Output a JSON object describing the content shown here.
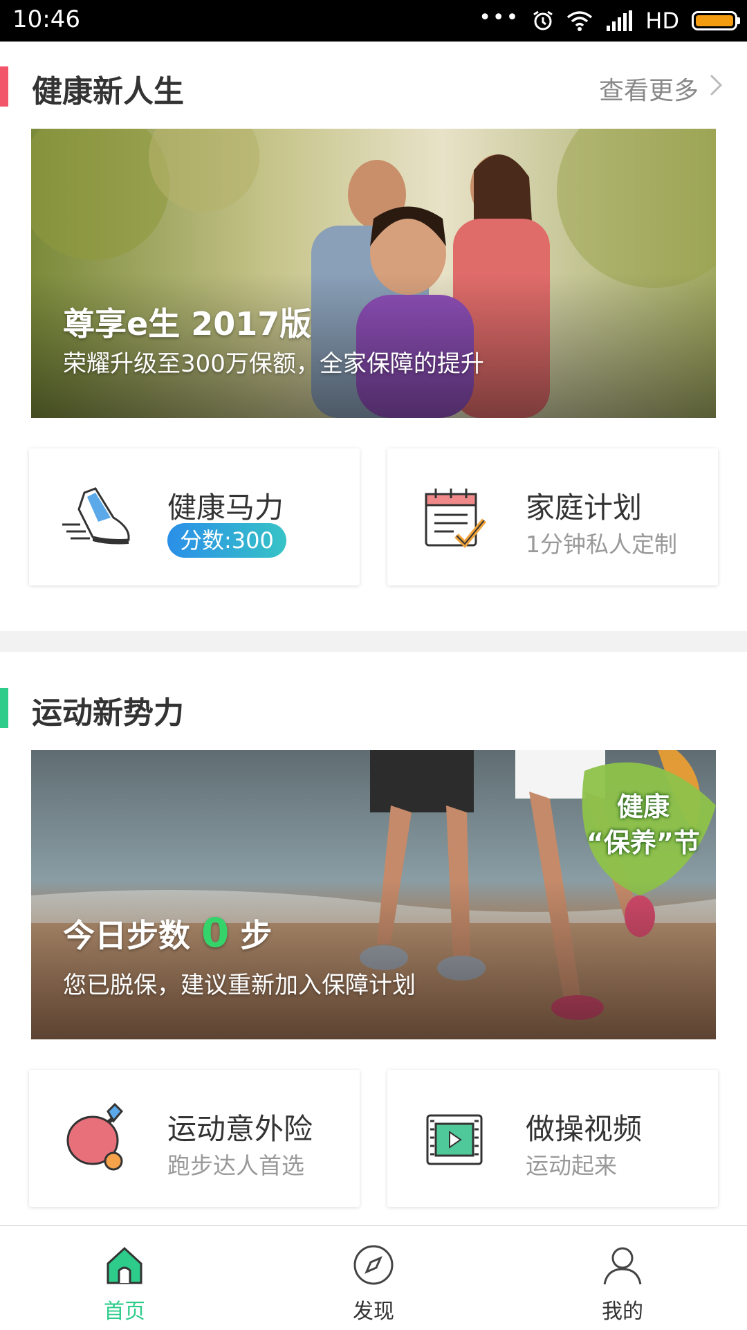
{
  "status_bar": {
    "time": "10:46",
    "dots": "•••",
    "network": "HD",
    "battery_color": "#f39c12"
  },
  "section1": {
    "title": "健康新人生",
    "more_label": "查看更多",
    "accent_color": "#f2546a",
    "banner": {
      "title": "尊享e生 2017版",
      "subtitle": "荣耀升级至300万保额，全家保障的提升"
    },
    "cards": [
      {
        "title": "健康马力",
        "badge": "分数:300",
        "icon": "running-shoe-icon"
      },
      {
        "title": "家庭计划",
        "subtitle": "1分钟私人定制",
        "icon": "calendar-check-icon"
      }
    ]
  },
  "section2": {
    "title": "运动新势力",
    "accent_color": "#2ecc8a",
    "banner": {
      "steps_prefix": "今日步数",
      "steps_value": "0",
      "steps_suffix": "步",
      "subtitle": "您已脱保，建议重新加入保障计划",
      "badge_line1": "健康",
      "badge_line2": "“保养”节"
    },
    "cards": [
      {
        "title": "运动意外险",
        "subtitle": "跑步达人首选",
        "icon": "ping-pong-icon"
      },
      {
        "title": "做操视频",
        "subtitle": "运动起来",
        "icon": "video-play-icon"
      }
    ]
  },
  "bottom_nav": {
    "active_color": "#2ecc8a",
    "items": [
      {
        "label": "首页",
        "icon": "home-icon",
        "active": true
      },
      {
        "label": "发现",
        "icon": "compass-icon",
        "active": false
      },
      {
        "label": "我的",
        "icon": "user-icon",
        "active": false
      }
    ]
  }
}
